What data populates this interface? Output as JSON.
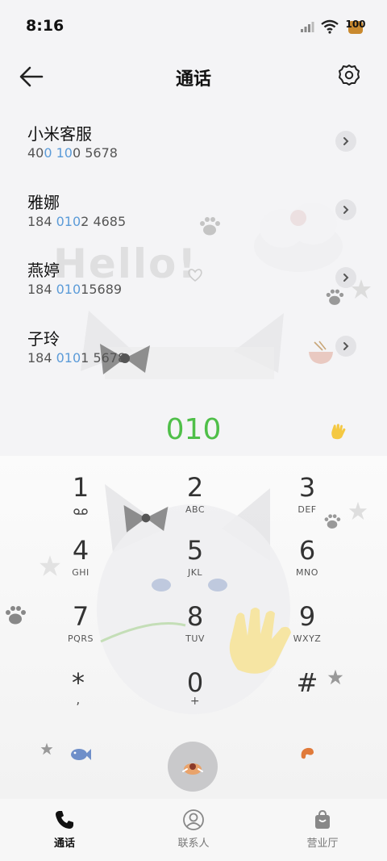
{
  "status_bar": {
    "time": "8:16",
    "battery": "100"
  },
  "header": {
    "title": "通话"
  },
  "contacts": [
    {
      "name": "小米客服",
      "number_parts": [
        "40",
        "0 10",
        "0 5678"
      ]
    },
    {
      "name": "雅娜",
      "number_parts": [
        "184 ",
        "010",
        "2 4685"
      ]
    },
    {
      "name": "燕婷",
      "number_parts": [
        "184 ",
        "010",
        "15689"
      ]
    },
    {
      "name": "子玲",
      "number_parts": [
        "184 ",
        "010",
        "1 5678"
      ]
    }
  ],
  "decor_text": "Hello!",
  "dialed_number": "010",
  "keypad": [
    {
      "digit": "1",
      "letters": ""
    },
    {
      "digit": "2",
      "letters": "ABC"
    },
    {
      "digit": "3",
      "letters": "DEF"
    },
    {
      "digit": "4",
      "letters": "GHI"
    },
    {
      "digit": "5",
      "letters": "JKL"
    },
    {
      "digit": "6",
      "letters": "MNO"
    },
    {
      "digit": "7",
      "letters": "PQRS"
    },
    {
      "digit": "8",
      "letters": "TUV"
    },
    {
      "digit": "9",
      "letters": "WXYZ"
    },
    {
      "digit": "*",
      "letters": ","
    },
    {
      "digit": "0",
      "letters": "+"
    },
    {
      "digit": "#",
      "letters": ""
    }
  ],
  "bottom_nav": [
    {
      "label": "通话",
      "icon": "phone-icon",
      "active": true
    },
    {
      "label": "联系人",
      "icon": "person-icon",
      "active": false
    },
    {
      "label": "营业厅",
      "icon": "shopping-bag-icon",
      "active": false
    }
  ],
  "colors": {
    "dialed": "#4fbf49",
    "highlight": "#5b9bd8",
    "call_button": "#c9c9cb"
  }
}
